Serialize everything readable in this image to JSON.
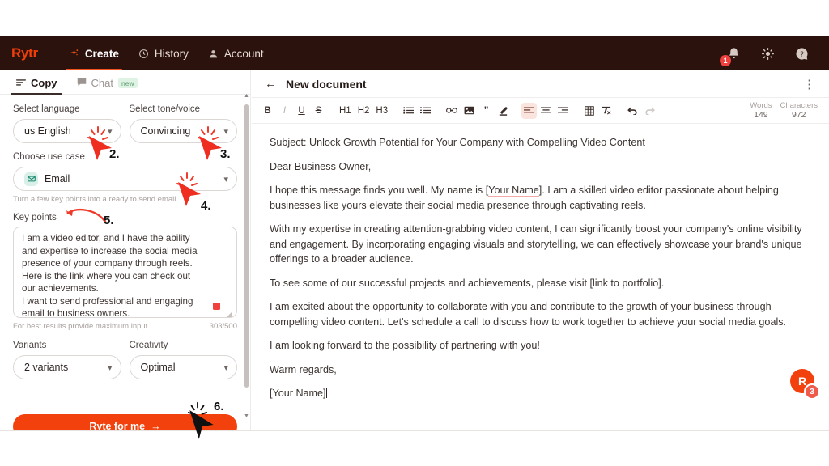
{
  "topnav": {
    "logo": "Rytr",
    "items": [
      {
        "label": "Create",
        "icon": "sparkle-icon",
        "active": true
      },
      {
        "label": "History",
        "icon": "clock-icon",
        "active": false
      },
      {
        "label": "Account",
        "icon": "person-icon",
        "active": false
      }
    ],
    "notification_count": "1",
    "icons": [
      "bell-icon",
      "sun-icon",
      "help-icon"
    ]
  },
  "sidebar": {
    "tabs": [
      {
        "label": "Copy",
        "icon": "lines-icon",
        "active": true,
        "badge": ""
      },
      {
        "label": "Chat",
        "icon": "chat-bubble-icon",
        "active": false,
        "badge": "new"
      }
    ],
    "language": {
      "label": "Select language",
      "value": "us English"
    },
    "tone": {
      "label": "Select tone/voice",
      "value": "Convincing"
    },
    "usecase": {
      "label": "Choose use case",
      "value": "Email",
      "hint": "Turn a few key points into a ready to send email"
    },
    "keypoints": {
      "label": "Key points",
      "lines": [
        "I am a video editor, and I have the ability",
        "and expertise to increase the social media",
        "presence of your company through reels.",
        "Here is the link where you can check out",
        "our achievements.",
        "I want to send professional and engaging",
        "email to business owners."
      ],
      "helper": "For best results provide maximum input",
      "counter": "303/500"
    },
    "variants": {
      "label": "Variants",
      "value": "2 variants"
    },
    "creativity": {
      "label": "Creativity",
      "value": "Optimal"
    },
    "submit": {
      "label": "Ryte for me",
      "arrow": "→"
    }
  },
  "editor": {
    "back_icon": "back-arrow-icon",
    "title": "New document",
    "menu_icon": "kebab-menu-icon",
    "toolbar": [
      {
        "name": "bold",
        "glyph": "B",
        "active": false,
        "dim": false
      },
      {
        "name": "italic",
        "glyph": "I",
        "active": false,
        "dim": false
      },
      {
        "name": "underline",
        "glyph": "U",
        "active": false,
        "dim": false
      },
      {
        "name": "strikethrough",
        "glyph": "S",
        "active": false,
        "dim": false
      },
      {
        "name": "heading-1",
        "glyph": "H1",
        "active": false,
        "dim": false
      },
      {
        "name": "heading-2",
        "glyph": "H2",
        "active": false,
        "dim": false
      },
      {
        "name": "heading-3",
        "glyph": "H3",
        "active": false,
        "dim": false
      },
      {
        "name": "bulleted-list",
        "glyph": "☰",
        "active": false,
        "dim": false
      },
      {
        "name": "numbered-list",
        "glyph": "☷",
        "active": false,
        "dim": false
      },
      {
        "name": "link",
        "glyph": "∞",
        "active": false,
        "dim": false
      },
      {
        "name": "image",
        "glyph": "▣",
        "active": false,
        "dim": false
      },
      {
        "name": "quote",
        "glyph": "”",
        "active": false,
        "dim": false
      },
      {
        "name": "highlighter",
        "glyph": "✐",
        "active": false,
        "dim": false
      },
      {
        "name": "align-left",
        "glyph": "≡",
        "active": true,
        "dim": false
      },
      {
        "name": "align-center",
        "glyph": "≡",
        "active": false,
        "dim": false
      },
      {
        "name": "align-right",
        "glyph": "≡",
        "active": false,
        "dim": false
      },
      {
        "name": "table",
        "glyph": "▦",
        "active": false,
        "dim": false
      },
      {
        "name": "clear-formatting",
        "glyph": "✗",
        "active": false,
        "dim": false
      },
      {
        "name": "undo",
        "glyph": "↶",
        "active": false,
        "dim": false
      },
      {
        "name": "redo",
        "glyph": "↷",
        "active": false,
        "dim": true
      }
    ],
    "counts": {
      "words_label": "Words",
      "words_value": "149",
      "chars_label": "Characters",
      "chars_value": "972"
    },
    "document": {
      "subject": "Subject: Unlock Growth Potential for Your Company with Compelling Video Content",
      "greeting": "Dear Business Owner,",
      "p1_a": "I hope this message finds you well. My name is [",
      "p1_sp": "Your Name",
      "p1_b": "]. I am a skilled video editor passionate about helping businesses like yours elevate their social media presence through captivating reels.",
      "p2": "With my expertise in creating attention-grabbing video content, I can significantly boost your company's online visibility and engagement. By incorporating engaging visuals and storytelling, we can effectively showcase your brand's unique offerings to a broader audience.",
      "p3": "To see some of our successful projects and achievements, please visit [link to portfolio].",
      "p4": "I am excited about the opportunity to collaborate with you and contribute to the growth of your business through compelling video content. Let's schedule a call to discuss how to work together to achieve your social media goals.",
      "p5": "I am looking forward to the possibility of partnering with you!",
      "p6": "Warm regards,",
      "p7": "[Your Name]"
    }
  },
  "annotations": [
    {
      "num": "2.",
      "type": "cursor-arrow"
    },
    {
      "num": "3.",
      "type": "cursor-arrow"
    },
    {
      "num": "4.",
      "type": "cursor-arrow"
    },
    {
      "num": "5.",
      "type": "curved-arrow"
    },
    {
      "num": "6.",
      "type": "cursor-arrow"
    }
  ],
  "fab": {
    "icon": "rytr-chat-icon",
    "badge": "3"
  }
}
